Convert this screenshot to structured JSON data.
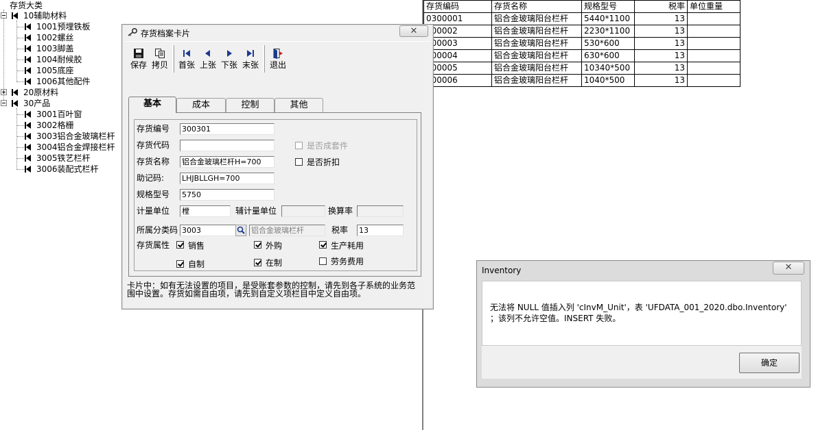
{
  "tree": {
    "root": "存货大类",
    "nodes": [
      {
        "label": "10辅助材料",
        "level": 1
      },
      {
        "label": "1001预埋铁板",
        "level": 2
      },
      {
        "label": "1002螺丝",
        "level": 2
      },
      {
        "label": "1003脚盖",
        "level": 2
      },
      {
        "label": "1004耐候胶",
        "level": 2
      },
      {
        "label": "1005底座",
        "level": 2
      },
      {
        "label": "1006其他配件",
        "level": 2
      },
      {
        "label": "20原材料",
        "level": 1
      },
      {
        "label": "30产品",
        "level": 1
      },
      {
        "label": "3001百叶窗",
        "level": 2
      },
      {
        "label": "3002格栅",
        "level": 2
      },
      {
        "label": "3003铝合金玻璃栏杆",
        "level": 2
      },
      {
        "label": "3004铝合金焊接栏杆",
        "level": 2
      },
      {
        "label": "3005铁艺栏杆",
        "level": 2
      },
      {
        "label": "3006装配式栏杆",
        "level": 2
      }
    ]
  },
  "grid": {
    "headers": [
      "存货编码",
      "存货名称",
      "规格型号",
      "税率",
      "单位重量"
    ],
    "rows": [
      [
        "0300001",
        "铝合金玻璃阳台栏杆",
        "5440*1100",
        "13",
        ""
      ],
      [
        "300002",
        "铝合金玻璃阳台栏杆",
        "2230*1100",
        "13",
        ""
      ],
      [
        "300003",
        "铝合金玻璃阳台栏杆",
        "530*600",
        "13",
        ""
      ],
      [
        "300004",
        "铝合金玻璃阳台栏杆",
        "630*600",
        "13",
        ""
      ],
      [
        "300005",
        "铝合金玻璃阳台栏杆",
        "10340*500",
        "13",
        ""
      ],
      [
        "300006",
        "铝合金玻璃阳台栏杆",
        "1040*500",
        "13",
        ""
      ]
    ]
  },
  "card": {
    "title": "存货档案卡片",
    "toolbar": {
      "save": "保存",
      "copy": "拷贝",
      "first": "首张",
      "prev": "上张",
      "next": "下张",
      "last": "末张",
      "exit": "退出"
    },
    "tabs": [
      "基本",
      "成本",
      "控制",
      "其他"
    ],
    "fields": {
      "code_label": "存货编号",
      "code_value": "300301",
      "alias_label": "存货代码",
      "alias_value": "",
      "name_label": "存货名称",
      "name_value": "铝合金玻璃栏杆H=700",
      "mnemonic_label": "助记码:",
      "mnemonic_value": "LHJBLLGH=700",
      "spec_label": "规格型号",
      "spec_value": "5750",
      "unit_label": "计量单位",
      "unit_value": "樘",
      "aux_unit_label": "辅计量单位",
      "aux_unit_value": "",
      "rate_conv_label": "换算率",
      "rate_conv_value": "",
      "category_label": "所属分类码",
      "category_code": "3003",
      "category_name": "铝合金玻璃栏杆",
      "tax_label": "税率",
      "tax_value": "13",
      "attr_label": "存货属性"
    },
    "checks": {
      "kit": {
        "label": "是否成套件",
        "checked": false
      },
      "discount": {
        "label": "是否折扣",
        "checked": false
      },
      "sale": {
        "label": "销售",
        "checked": true
      },
      "purchase": {
        "label": "外购",
        "checked": true
      },
      "production": {
        "label": "生产耗用",
        "checked": true
      },
      "self_made": {
        "label": "自制",
        "checked": true
      },
      "wip": {
        "label": "在制",
        "checked": true
      },
      "service": {
        "label": "劳务费用",
        "checked": false
      }
    },
    "note": "卡片中：如有无法设置的项目，是受账套参数的控制，请先到各子系统的业务范围中设置。存货如需自由项，请先到自定义项栏目中定义自由项。"
  },
  "dialog": {
    "title": "Inventory",
    "message_line1": "无法将 NULL 值插入列 'cInvM_Unit'，表 'UFDATA_001_2020.dbo.Inventory'",
    "message_line2": "；该列不允许空值。INSERT 失败。",
    "ok": "确定"
  }
}
